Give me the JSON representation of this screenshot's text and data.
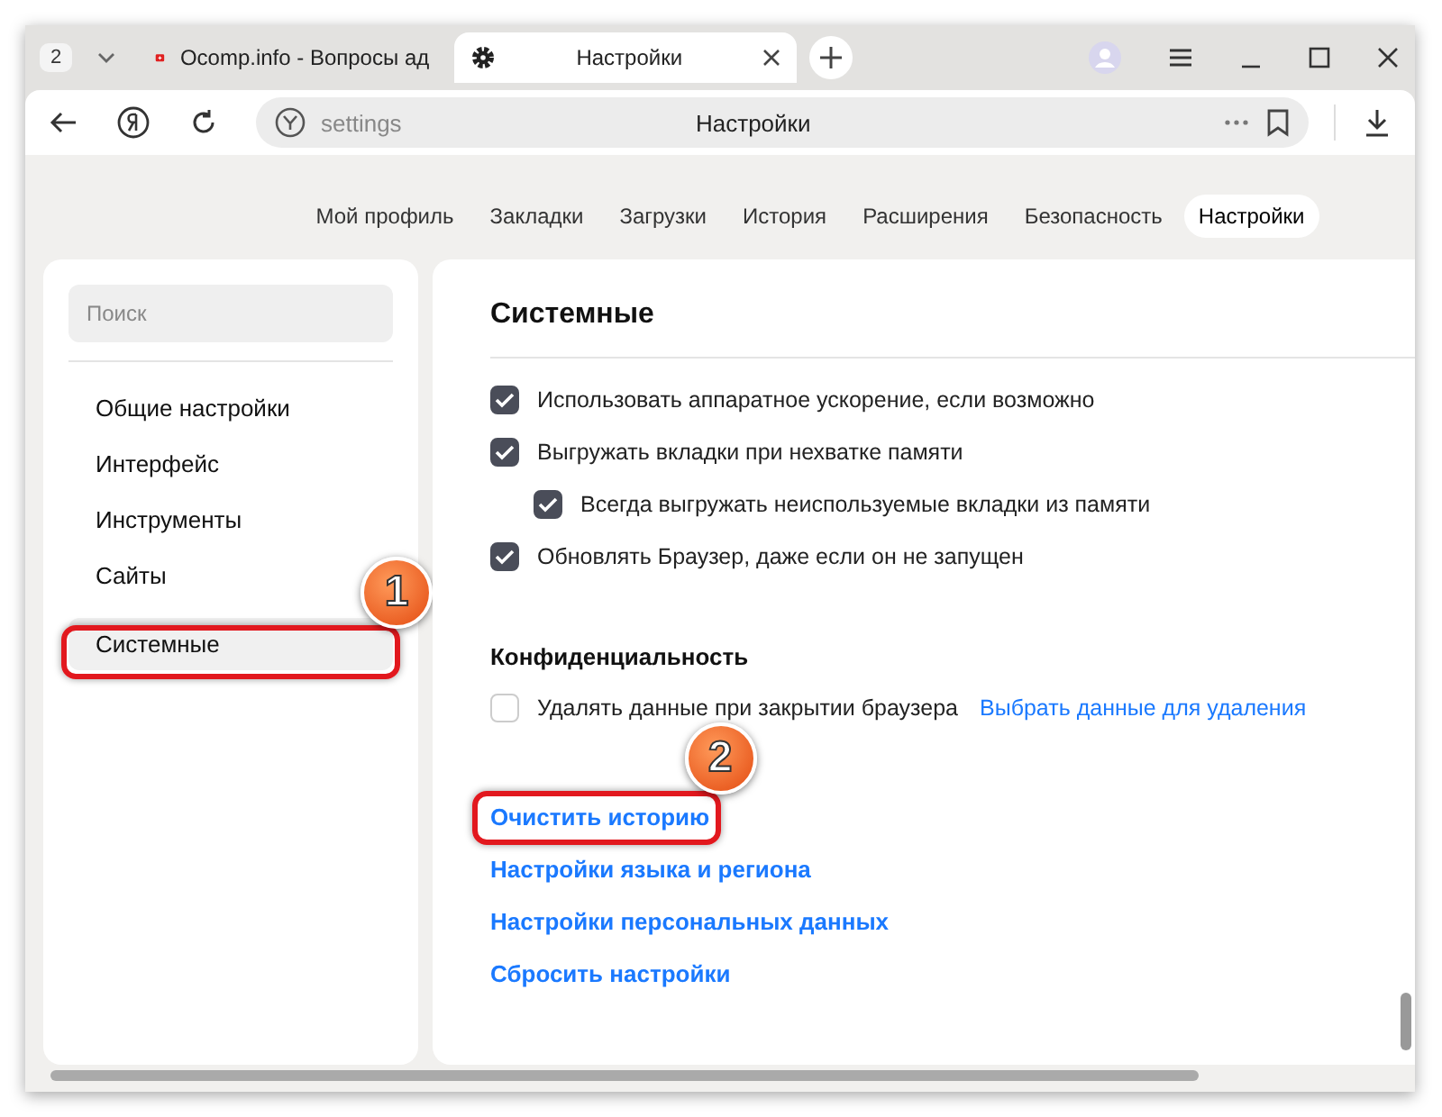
{
  "tab_strip": {
    "tab_count": "2",
    "tabs": [
      {
        "title": "Ocomp.info - Вопросы ад",
        "kind": "site",
        "selected": false
      },
      {
        "title": "Настройки",
        "kind": "settings",
        "selected": true
      }
    ]
  },
  "address_bar": {
    "url": "settings",
    "page_title": "Настройки"
  },
  "settings_nav": [
    {
      "label": "Мой профиль",
      "selected": false
    },
    {
      "label": "Закладки",
      "selected": false
    },
    {
      "label": "Загрузки",
      "selected": false
    },
    {
      "label": "История",
      "selected": false
    },
    {
      "label": "Расширения",
      "selected": false
    },
    {
      "label": "Безопасность",
      "selected": false
    },
    {
      "label": "Настройки",
      "selected": true
    }
  ],
  "sidebar": {
    "search": {
      "placeholder": "Поиск"
    },
    "items": [
      {
        "label": "Общие настройки",
        "selected": false
      },
      {
        "label": "Интерфейс",
        "selected": false
      },
      {
        "label": "Инструменты",
        "selected": false
      },
      {
        "label": "Сайты",
        "selected": false
      },
      {
        "label": "Системные",
        "selected": true,
        "annotation": "1"
      }
    ]
  },
  "main": {
    "title": "Системные",
    "options": [
      {
        "label": "Использовать аппаратное ускорение, если возможно",
        "checked": true
      },
      {
        "label": "Выгружать вкладки при нехватке памяти",
        "checked": true,
        "children": [
          {
            "label": "Всегда выгружать неиспользуемые вкладки из памяти",
            "checked": true
          }
        ]
      },
      {
        "label": "Обновлять Браузер, даже если он не запущен",
        "checked": true
      }
    ],
    "privacy": {
      "title": "Конфиденциальность",
      "option": {
        "label": "Удалять данные при закрытии браузера",
        "checked": false
      },
      "link": "Выбрать данные для удаления"
    },
    "links": [
      {
        "label": "Очистить историю",
        "annotation": "2"
      },
      {
        "label": "Настройки языка и региона"
      },
      {
        "label": "Настройки персональных данных"
      },
      {
        "label": "Сбросить настройки"
      }
    ]
  }
}
